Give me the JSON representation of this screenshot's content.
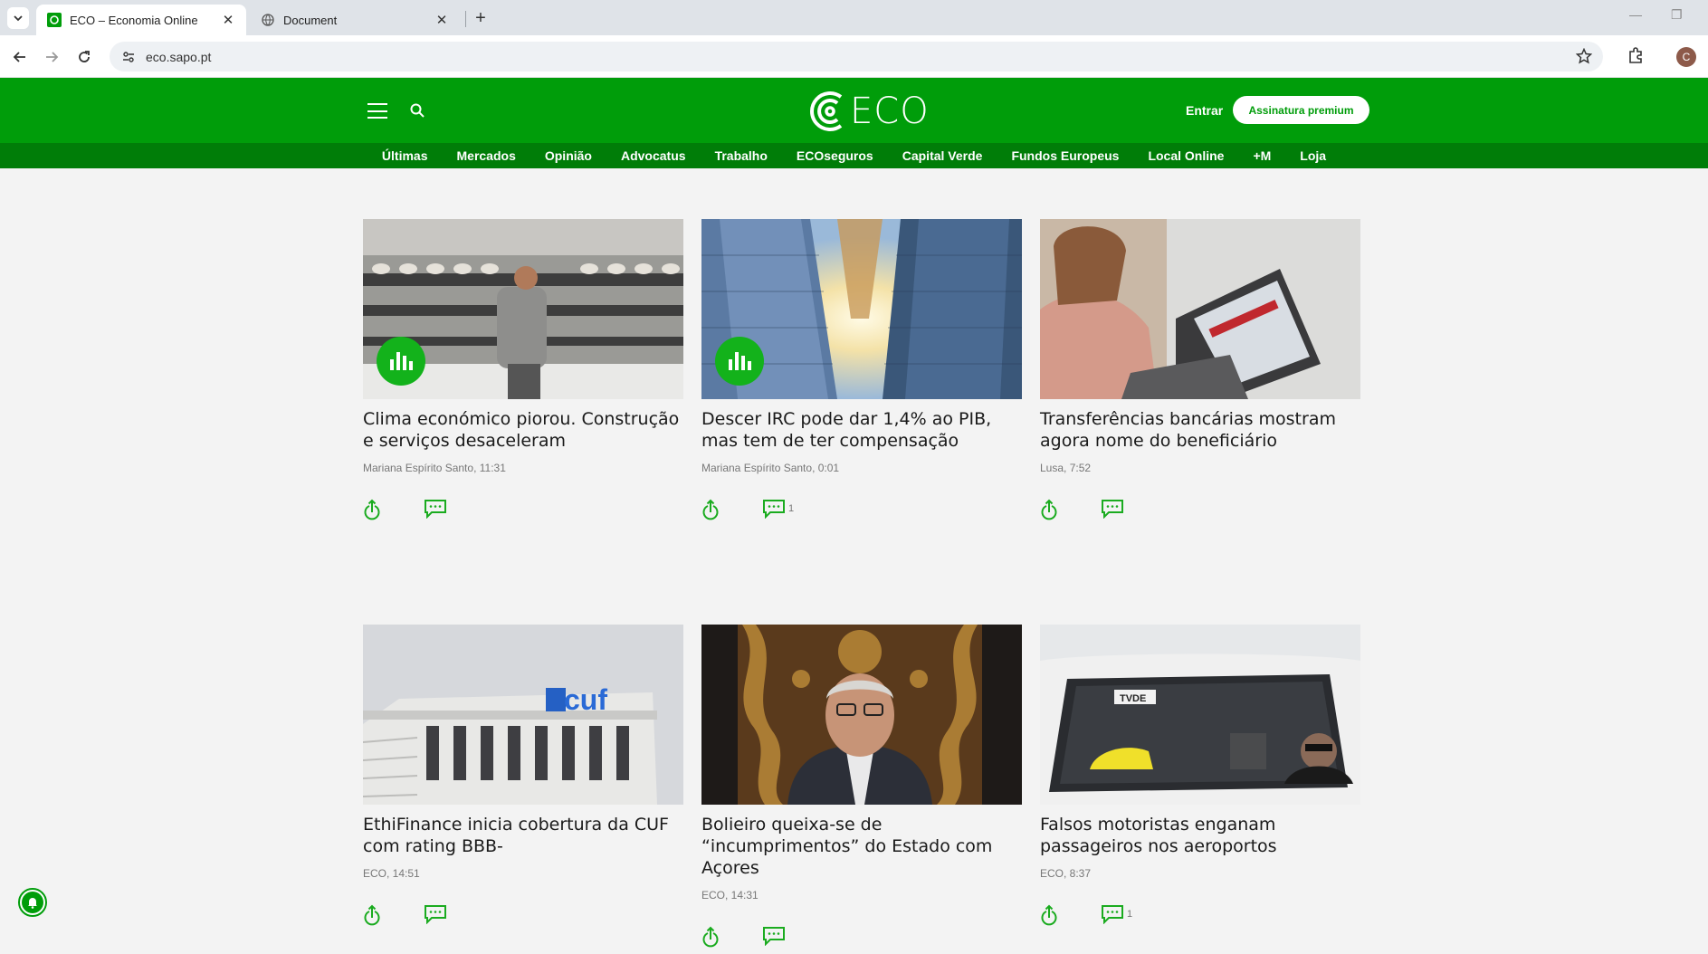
{
  "browser": {
    "tabs": [
      {
        "title": "ECO – Economia Online"
      },
      {
        "title": "Document"
      }
    ],
    "url": "eco.sapo.pt",
    "profile_initial": "C"
  },
  "site": {
    "logo_text": "ECO",
    "login_label": "Entrar",
    "premium_label": "Assinatura premium",
    "brand_color": "#009d0a",
    "menu": [
      "Últimas",
      "Mercados",
      "Opinião",
      "Advocatus",
      "Trabalho",
      "ECOseguros",
      "Capital Verde",
      "Fundos Europeus",
      "Local Online",
      "+M",
      "Loja"
    ]
  },
  "articles": [
    {
      "headline": "Clima económico piorou. Construção e serviços desaceleram",
      "meta": "Mariana Espírito Santo, 11:31",
      "comments": "",
      "has_stats_badge": true
    },
    {
      "headline": "Descer IRC pode dar 1,4% ao PIB, mas tem de ter compensação",
      "meta": "Mariana Espírito Santo, 0:01",
      "comments": "1",
      "has_stats_badge": true
    },
    {
      "headline": "Transferências bancárias mostram agora nome do beneficiário",
      "meta": "Lusa, 7:52",
      "comments": "",
      "has_stats_badge": false
    },
    {
      "headline": "EthiFinance inicia cobertura da CUF com rating BBB-",
      "meta": "ECO, 14:51",
      "comments": "",
      "has_stats_badge": false
    },
    {
      "headline": "Bolieiro queixa-se de “incumprimentos” do Estado com Açores",
      "meta": "ECO, 14:31",
      "comments": "",
      "has_stats_badge": false
    },
    {
      "headline": "Falsos motoristas enganam passageiros nos aeroportos",
      "meta": "ECO, 8:37",
      "comments": "1",
      "has_stats_badge": false
    }
  ]
}
